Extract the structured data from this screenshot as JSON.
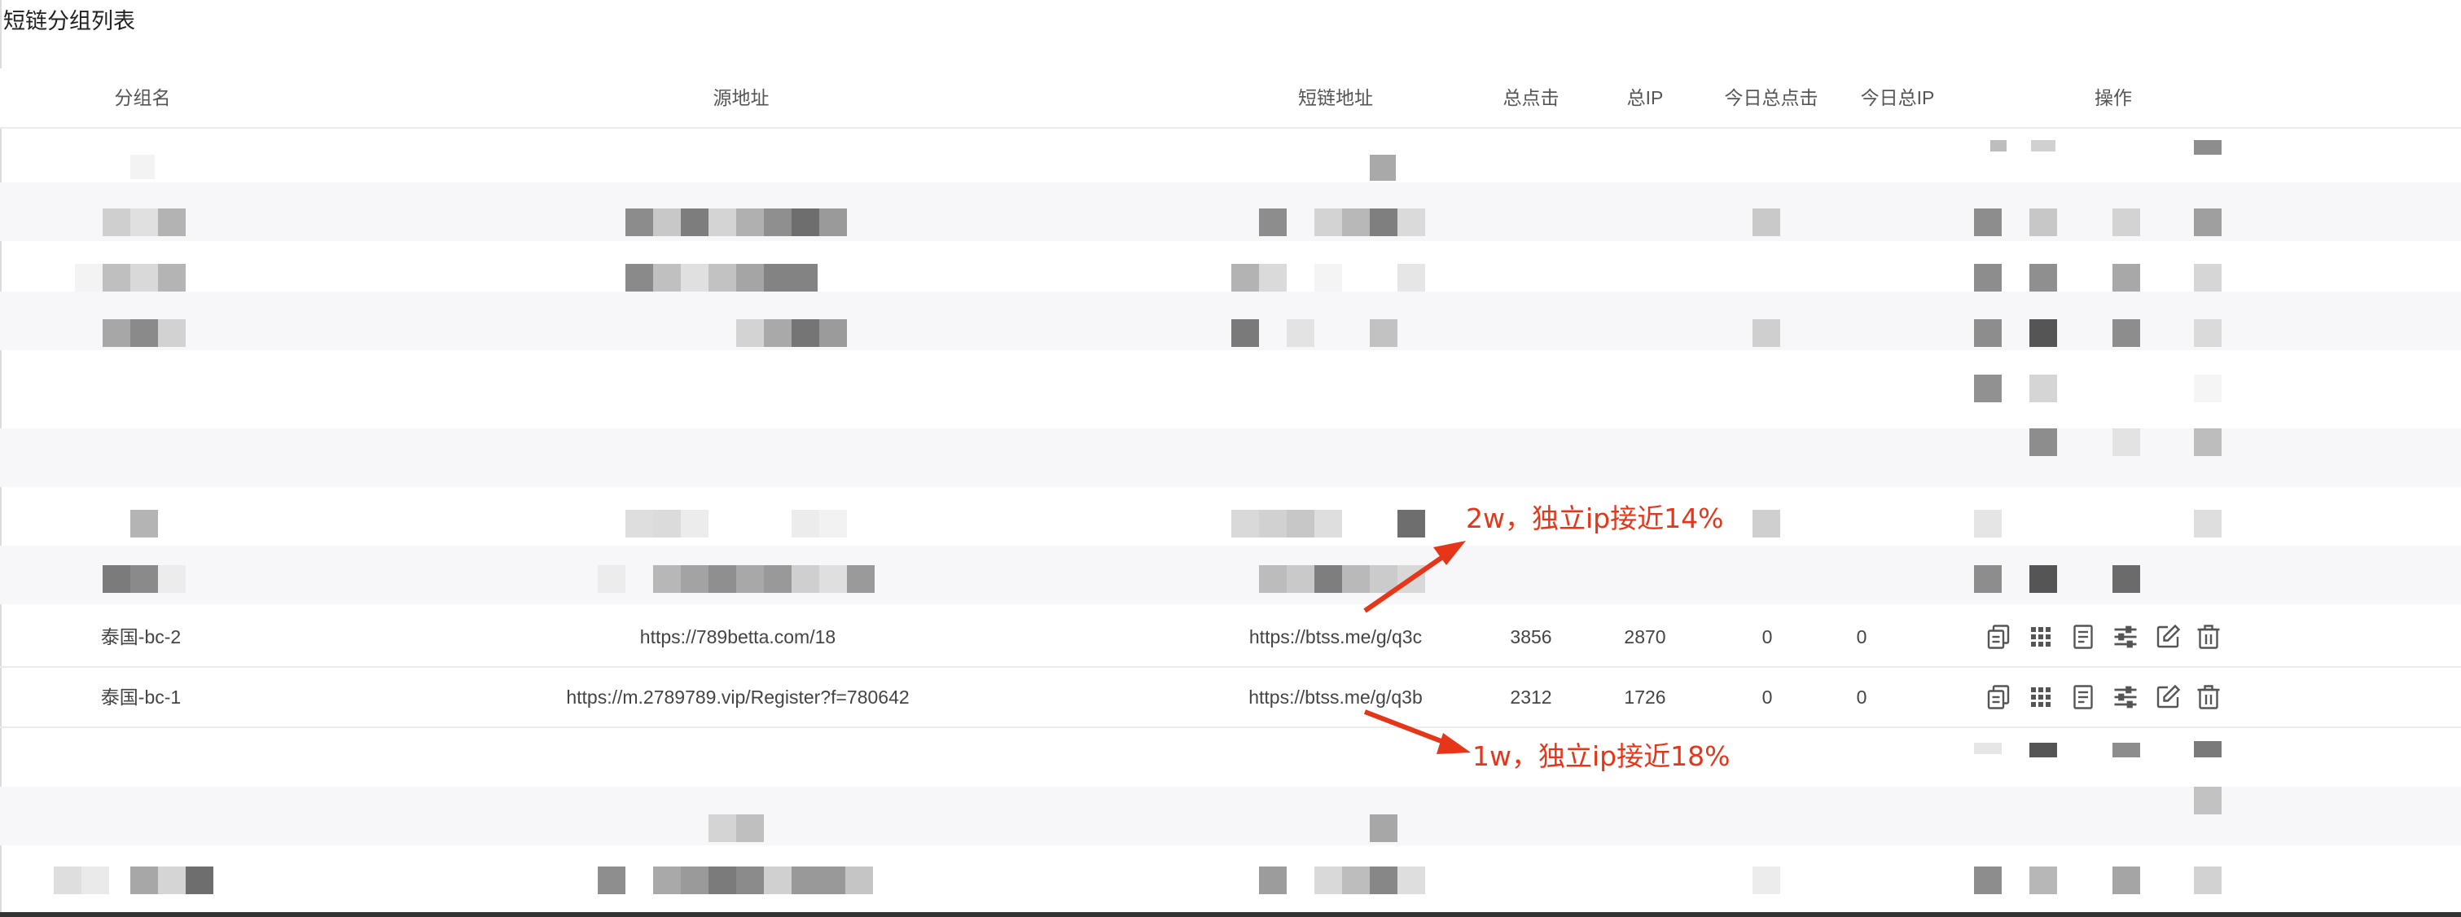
{
  "page": {
    "title": "短链分组列表"
  },
  "table": {
    "headers": {
      "group_name": "分组名",
      "source_url": "源地址",
      "short_url": "短链地址",
      "total_clicks": "总点击",
      "total_ip": "总IP",
      "today_clicks": "今日总点击",
      "today_ip": "今日总IP",
      "actions": "操作"
    },
    "rows": [
      {
        "group_name": "泰国-bc-2",
        "source_url": "https://789betta.com/18",
        "short_url": "https://btss.me/g/q3c",
        "total_clicks": "3856",
        "total_ip": "2870",
        "today_clicks": "0",
        "today_ip": "0"
      },
      {
        "group_name": "泰国-bc-1",
        "source_url": "https://m.2789789.vip/Register?f=780642",
        "short_url": "https://btss.me/g/q3b",
        "total_clicks": "2312",
        "total_ip": "1726",
        "today_clicks": "0",
        "today_ip": "0"
      }
    ],
    "action_icons": [
      "copy-icon",
      "qrcode-icon",
      "document-icon",
      "sliders-icon",
      "edit-icon",
      "trash-icon"
    ]
  },
  "annotations": {
    "top": "2w，独立ip接近14%",
    "bottom": "1w，独立ip接近18%",
    "color": "#e6361a"
  }
}
